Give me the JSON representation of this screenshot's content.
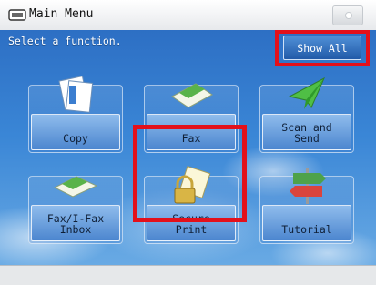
{
  "window": {
    "title": "Main Menu"
  },
  "main": {
    "prompt": "Select a function.",
    "show_all_label": "Show All",
    "tiles": [
      {
        "label": "Copy",
        "icon": "copy-icon"
      },
      {
        "label": "Fax",
        "icon": "fax-icon"
      },
      {
        "label": "Scan and\nSend",
        "icon": "scan-send-icon"
      },
      {
        "label": "Fax/I-Fax\nInbox",
        "icon": "fax-inbox-icon"
      },
      {
        "label": "Secure\nPrint",
        "icon": "secure-print-icon"
      },
      {
        "label": "Tutorial",
        "icon": "tutorial-icon"
      }
    ]
  },
  "colors": {
    "highlight": "#e3101b",
    "accent": "#215aa8"
  }
}
